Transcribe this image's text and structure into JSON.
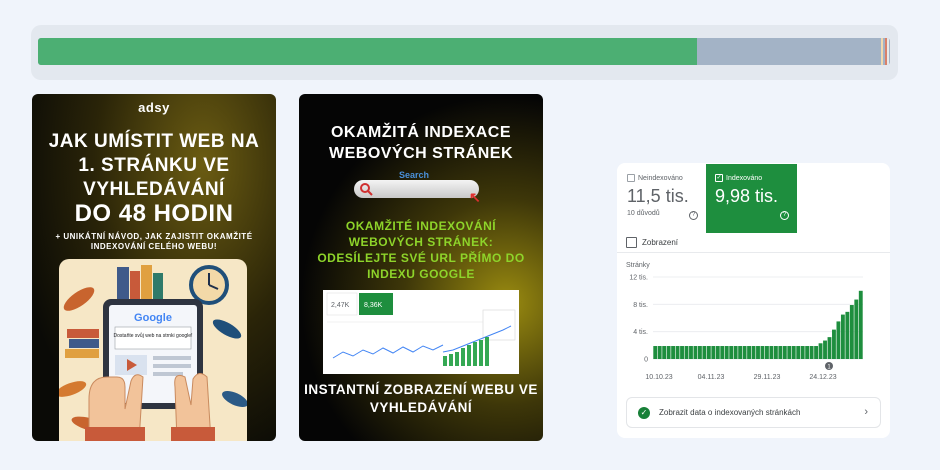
{
  "progress": {
    "value_percent": 77.3,
    "fill_color": "#4caf73",
    "track_color": "#a3b3c6",
    "end_markers": [
      {
        "at_percent": 99.0,
        "color": "#f0d9b0"
      },
      {
        "at_percent": 99.4,
        "color": "#d8806a"
      },
      {
        "at_percent": 99.7,
        "color": "#e8e8e8"
      }
    ]
  },
  "banner1": {
    "brand": "adsy",
    "headline": "JAK UMÍSTIT WEB NA 1. STRÁNKU VE VYHLEDÁVÁNÍ",
    "emphasis": "DO 48 HODIN",
    "subline": "+ UNIKÁTNÍ NÁVOD, JAK ZAJISTIT OKAMŽITÉ INDEXOVÁNÍ CELÉHO WEBU!",
    "illustration": {
      "logo_text": "Google",
      "screen_text": "Dostaňte svůj web na strnki google!",
      "icons": [
        "tablet-icon",
        "hands-icon",
        "clock-icon",
        "books-icon",
        "leaf-icon"
      ]
    }
  },
  "banner2": {
    "headline": "OKAMŽITÁ INDEXACE WEBOVÝCH STRÁNEK",
    "search_label": "Search",
    "search_icon": "magnifier-icon",
    "green_text": "OKAMŽITÉ INDEXOVÁNÍ WEBOVÝCH STRÁNEK: ODESÍLEJTE SVÉ URL PŘÍMO DO INDEXU GOOGLE",
    "mini_values": {
      "left": "2,47K",
      "right": "8,36K"
    },
    "bottom_text": "INSTANTNÍ ZOBRAZENÍ WEBU VE VYHLEDÁVÁNÍ"
  },
  "gsc": {
    "not_indexed": {
      "label": "Neindexováno",
      "value": "11,5 tis.",
      "sub": "10 důvodů",
      "color": "#5f6368"
    },
    "indexed": {
      "label": "Indexováno",
      "value": "9,98 tis.",
      "color": "#1e8e3e"
    },
    "impressions_label": "Zobrazení",
    "cta_text": "Zobrazit data o indexovaných stránkách",
    "cta_icon": "check-circle-icon",
    "annotation_marker": "1"
  },
  "chart_data": {
    "type": "bar",
    "ylabel": "Stránky",
    "ylim": [
      0,
      12000
    ],
    "y_ticks": [
      "12 tis.",
      "8 tis.",
      "4 tis.",
      "0"
    ],
    "y_tick_values": [
      12000,
      8000,
      4000,
      0
    ],
    "x_ticks": [
      "10.10.23",
      "04.11.23",
      "29.11.23",
      "24.12.23"
    ],
    "bar_color": "#1e8e3e",
    "values": [
      1900,
      1900,
      1900,
      1900,
      1900,
      1900,
      1900,
      1900,
      1900,
      1900,
      1900,
      1900,
      1900,
      1900,
      1900,
      1900,
      1900,
      1900,
      1900,
      1900,
      1900,
      1900,
      1900,
      1900,
      1900,
      1900,
      1900,
      1900,
      1900,
      1900,
      1900,
      1900,
      1900,
      1900,
      1900,
      1900,
      1900,
      2300,
      2700,
      3200,
      4300,
      5500,
      6500,
      6900,
      7900,
      8700,
      9980
    ]
  }
}
